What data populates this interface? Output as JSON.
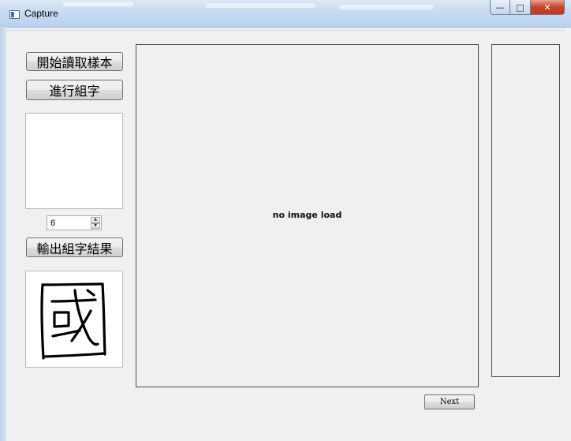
{
  "window": {
    "title": "Capture",
    "controls": {
      "minimize": "—",
      "maximize": "□",
      "close": "✕"
    }
  },
  "sidebar": {
    "start_button": "開始讀取樣本",
    "compose_button": "進行組字",
    "count_value": "6",
    "output_button": "輸出組字結果",
    "result_char_icon": "handwritten-character-image"
  },
  "main": {
    "placeholder": "no image load"
  },
  "footer": {
    "next_button": "Next"
  }
}
